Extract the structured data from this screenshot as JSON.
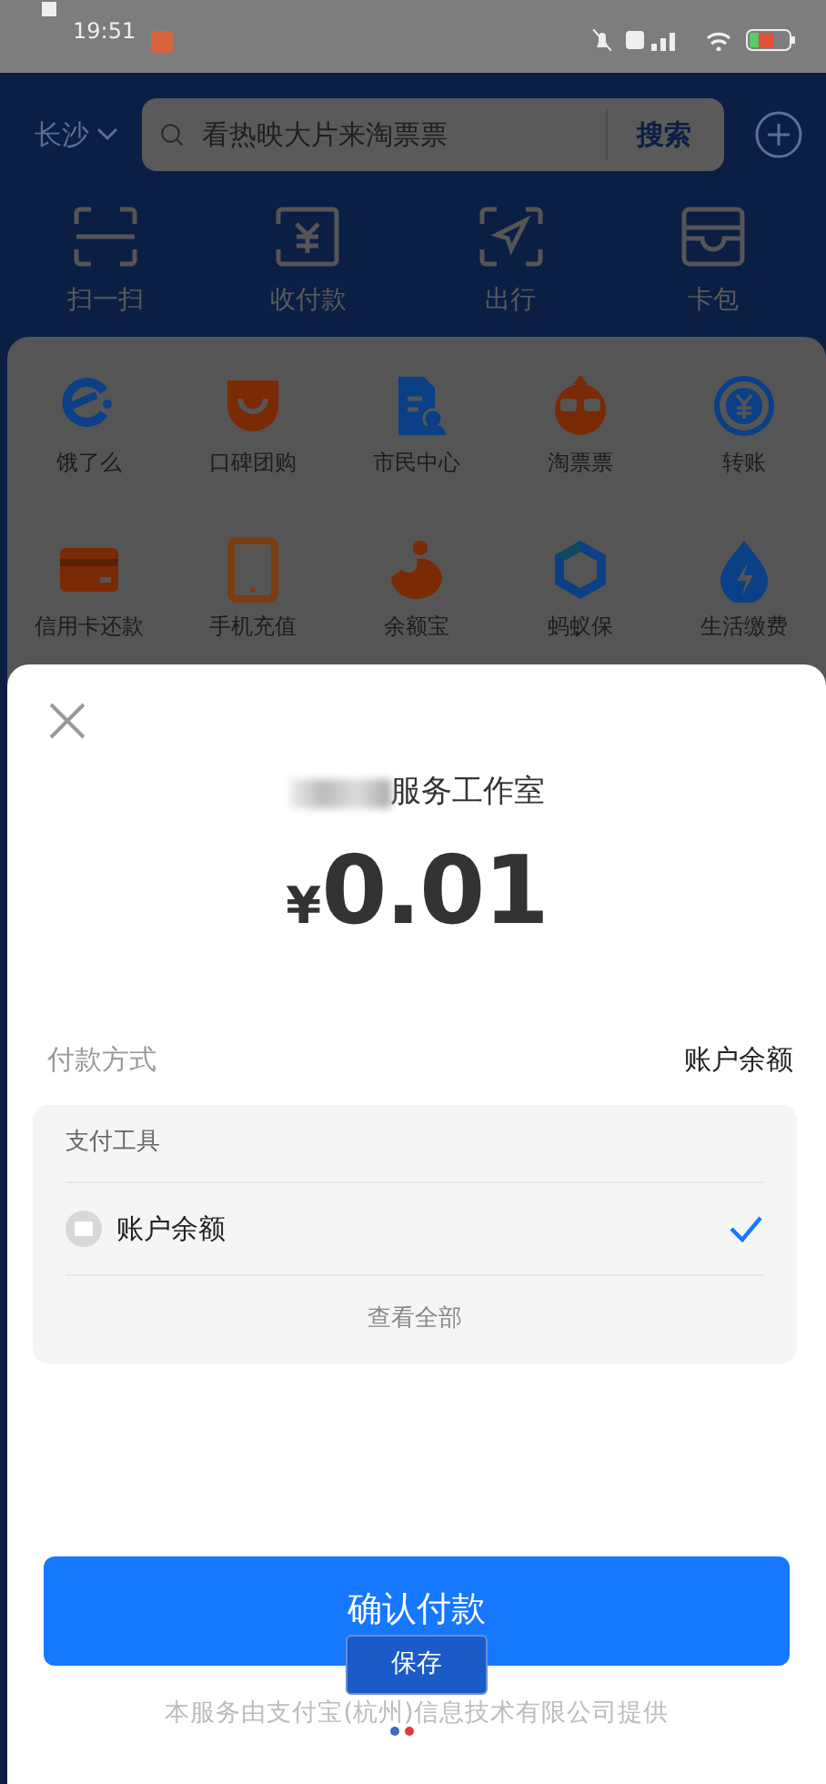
{
  "status_bar": {
    "time": "19:51"
  },
  "header": {
    "city": "长沙",
    "search": {
      "placeholder": "看热映大片来淘票票",
      "button": "搜索"
    }
  },
  "quick_actions": [
    {
      "label": "扫一扫",
      "kind": "scan"
    },
    {
      "label": "收付款",
      "kind": "pay"
    },
    {
      "label": "出行",
      "kind": "travel"
    },
    {
      "label": "卡包",
      "kind": "wallet"
    }
  ],
  "apps": [
    {
      "label": "饿了么",
      "kind": "eleme"
    },
    {
      "label": "口碑团购",
      "kind": "koubei"
    },
    {
      "label": "市民中心",
      "kind": "citizen"
    },
    {
      "label": "淘票票",
      "kind": "movie"
    },
    {
      "label": "转账",
      "kind": "transfer"
    },
    {
      "label": "信用卡还款",
      "kind": "card"
    },
    {
      "label": "手机充值",
      "kind": "phone"
    },
    {
      "label": "余额宝",
      "kind": "yuebao"
    },
    {
      "label": "蚂蚁保",
      "kind": "insure"
    },
    {
      "label": "生活缴费",
      "kind": "utility"
    }
  ],
  "payment_sheet": {
    "merchant": "服务工作室",
    "amount_symbol": "¥",
    "amount": "0.01",
    "method_label": "付款方式",
    "method_value": "账户余额",
    "tools_title": "支付工具",
    "tools": [
      {
        "label": "账户余额",
        "selected": true
      }
    ],
    "view_all": "查看全部",
    "confirm": "确认付款",
    "footer": "本服务由支付宝(杭州)信息技术有限公司提供"
  },
  "overlay_button": {
    "label": "保存"
  }
}
